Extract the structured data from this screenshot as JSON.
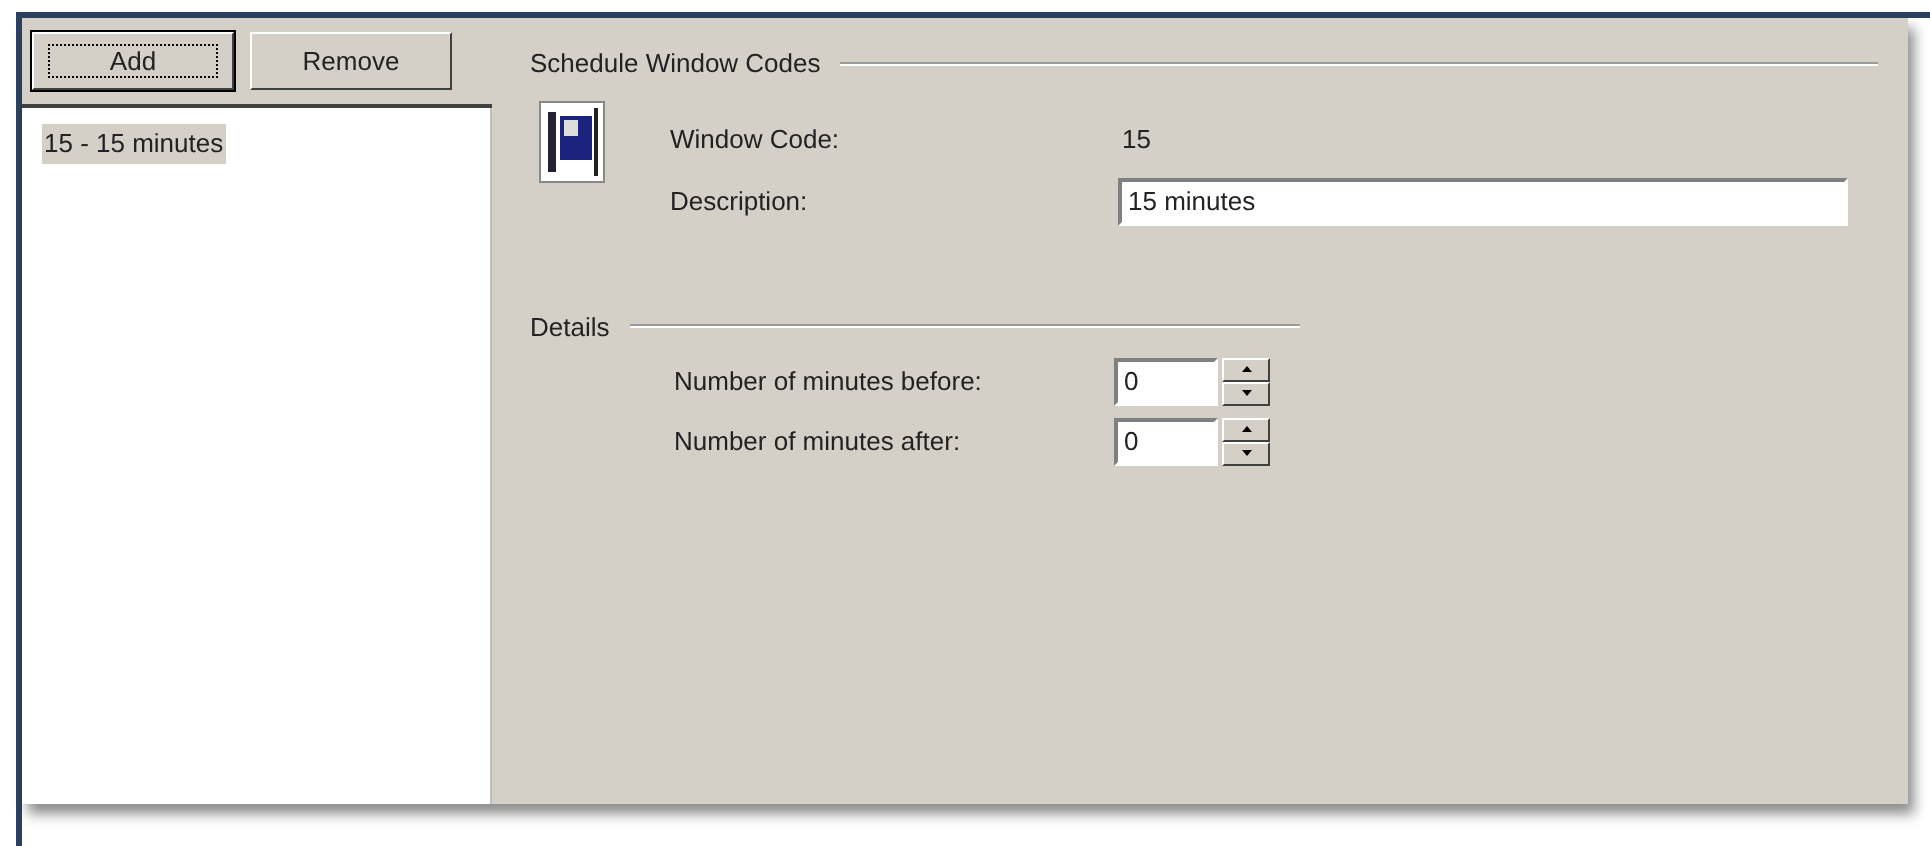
{
  "buttons": [
    {
      "label": "Add",
      "default": true
    },
    {
      "label": "Remove",
      "default": false
    }
  ],
  "list": {
    "items": [
      {
        "label": "15 - 15 minutes",
        "selected": true
      }
    ]
  },
  "schedule": {
    "title": "Schedule Window Codes",
    "code_label": "Window Code:",
    "code_value": "15",
    "description_label": "Description:",
    "description_value": "15 minutes"
  },
  "details": {
    "title": "Details",
    "rows": [
      {
        "label": "Number of minutes before:",
        "value": "0"
      },
      {
        "label": "Number of minutes after:",
        "value": "0"
      }
    ]
  }
}
